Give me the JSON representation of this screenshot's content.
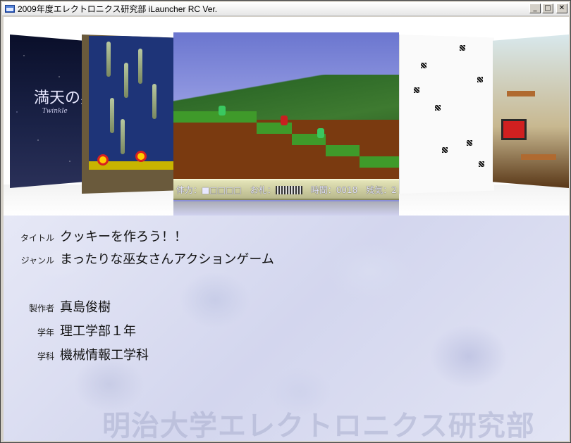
{
  "window": {
    "title": "2009年度エレクトロニクス研究部  iLauncher RC Ver.",
    "buttons": {
      "minimize": "_",
      "maximize": "□",
      "close": "✕"
    }
  },
  "carousel": {
    "card_a": {
      "big_text": "満天の星",
      "small_text": "Twinkle"
    },
    "main_hud": {
      "hp_label": "体力：",
      "hp_boxes": "■□□□□",
      "ofuda_label": "お札：",
      "time_label": "時間：0018",
      "spirit_label": "残気：",
      "spirit_value": "2"
    }
  },
  "info": {
    "title_label": "タイトル",
    "title_value": "クッキーを作ろう！！",
    "genre_label": "ジャンル",
    "genre_value": "まったりな巫女さんアクションゲーム",
    "author_label": "製作者",
    "author_value": "真島俊樹",
    "grade_label": "学年",
    "grade_value": "理工学部１年",
    "dept_label": "学科",
    "dept_value": "機械情報工学科",
    "watermark": "明治大学エレクトロニクス研究部"
  }
}
